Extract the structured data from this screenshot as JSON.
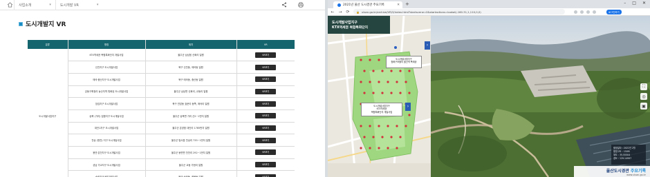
{
  "left": {
    "breadcrumb": [
      {
        "label": "사업소개"
      },
      {
        "label": "도시개발 VR"
      }
    ],
    "page_title": "도시개발지 VR",
    "table": {
      "headers": [
        "분류",
        "명칭",
        "위치",
        "VR"
      ],
      "division": "도시개발사업지구",
      "rows": [
        {
          "name": "KTX역세권 복합특화단지 개발사업",
          "location": "울주군 삼남읍 신화리 일원",
          "vr": "VR보기"
        },
        {
          "name": "신천지구 도시개발사업",
          "location": "북구 신천동, 매곡동 일원",
          "vr": "VR보기"
        },
        {
          "name": "매곡·중산지구 도시개발사업",
          "location": "북구 매곡동, 중산동 일원",
          "vr": "VR보기"
        },
        {
          "name": "강동구획정리 농산지역 특화된 도시개발사업",
          "location": "울주군 삼남면 신화리, 교동리 일원",
          "vr": "VR보기"
        },
        {
          "name": "장검지구 도시개발사업",
          "location": "북구 연암동 효문리 동쪽, 매곡리 일원",
          "vr": "VR보기"
        },
        {
          "name": "상북 (가리) 집합지구 도시개발사업",
          "location": "울주군 상북면 가리 산2~1번지 일원",
          "vr": "VR보기"
        },
        {
          "name": "대안1지구 도시개발사업",
          "location": "울주군 온양읍 대안리 1785번지 일원",
          "vr": "VR보기"
        },
        {
          "name": "천상 (명천) 지구 도시개발사업",
          "location": "울주군 범서읍 천상리 735~1번지 일원",
          "vr": "VR보기"
        },
        {
          "name": "용연·온천지구 도시개발사업",
          "location": "울주군 동면편 천천리 292~1번지 일원",
          "vr": "VR보기"
        },
        {
          "name": "성남 가교지구 도시개발사업",
          "location": "울주군 교동 가현리 일원",
          "vr": "VR보기"
        },
        {
          "name": "송정지구 택지개발사업",
          "location": "북구 송정동, 화봉동 일원",
          "vr": "VR보기"
        }
      ]
    }
  },
  "browser": {
    "tab_title": "2021년 울산 도시경관 주요기록",
    "url": "ulsan.go.kr/archive/VR/3/index.html?startscene=0&startactions=lookat(-160.31,1,110,0,0)",
    "login_label": "로그인하기"
  },
  "viewer": {
    "map_header_line1": "도시개발사업지구",
    "map_header_line2": "KTX역세권 복합특화단지",
    "popup_top": [
      "도시개발사업지구",
      "청화구조물의 출산역 폭제공"
    ],
    "popup_mid": [
      "도시개발사업지구",
      "KTX역세권",
      "복합특화단지 개발사업"
    ],
    "info_lines": [
      "촬영일자 : 2021년 2월",
      "촬영고도 : 150M",
      "위도 : 35.55504",
      "경도 : 129.14997"
    ],
    "brand_main_1": "울산도시경관",
    "brand_main_2": "주요기록",
    "brand_sub": "www.ulsan.go.kr"
  }
}
